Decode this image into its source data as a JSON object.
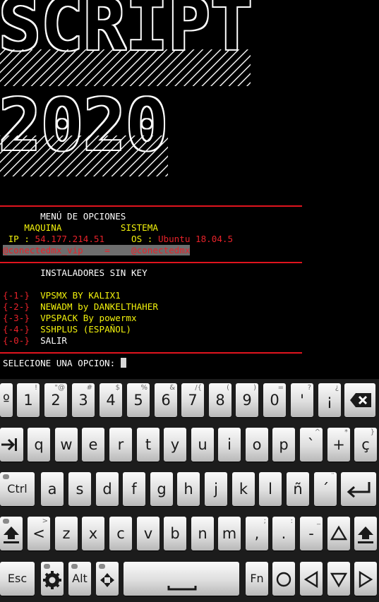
{
  "banner": {
    "line1": "SCRIPT",
    "line2": "2020"
  },
  "menu": {
    "title": "MENÚ DE OPCIONES",
    "col1": "MAQUINA",
    "col2": "SISTEMA",
    "ip_label": "IP : ",
    "ip_value": "54.177.214.51",
    "os_label": "OS : ",
    "os_value": "Ubuntu 18.04.5",
    "credit_left": "@conectedmx_vip",
    "credit_sep": "=",
    "credit_right": "@conectedmx",
    "section": "INSTALADORES SIN KEY",
    "options": [
      {
        "num": "{-1-}",
        "label": "VPSMX BY KALIX1"
      },
      {
        "num": "{-2-}",
        "label": "NEWADM by DANKELTHAHER"
      },
      {
        "num": "{-3-}",
        "label": "VPSPACK By powermx"
      },
      {
        "num": "{-4-}",
        "label": "SSHPLUS (ESPAÑOL)"
      },
      {
        "num": "{-0-}",
        "label": "SALIR"
      }
    ],
    "prompt": "SELECIONE UNA OPCION: "
  },
  "keyboard": {
    "rows": [
      [
        {
          "m": "º",
          "a": ""
        },
        {
          "m": "1",
          "a": "!"
        },
        {
          "m": "2",
          "a": "\"@"
        },
        {
          "m": "3",
          "a": "#"
        },
        {
          "m": "4",
          "a": "$"
        },
        {
          "m": "5",
          "a": "%"
        },
        {
          "m": "6",
          "a": "&"
        },
        {
          "m": "7",
          "a": "/{"
        },
        {
          "m": "8",
          "a": "("
        },
        {
          "m": "9",
          "a": ")"
        },
        {
          "m": "0",
          "a": "="
        },
        {
          "m": "'",
          "a": "?"
        },
        {
          "m": "¡",
          "a": "¿"
        },
        {
          "m": "",
          "a": "",
          "icon": "backspace-icon"
        }
      ],
      [
        {
          "m": "",
          "a": "",
          "icon": "tab-icon"
        },
        {
          "m": "q",
          "a": ""
        },
        {
          "m": "w",
          "a": ""
        },
        {
          "m": "e",
          "a": ""
        },
        {
          "m": "r",
          "a": ""
        },
        {
          "m": "t",
          "a": ""
        },
        {
          "m": "y",
          "a": ""
        },
        {
          "m": "u",
          "a": ""
        },
        {
          "m": "i",
          "a": ""
        },
        {
          "m": "o",
          "a": ""
        },
        {
          "m": "p",
          "a": ""
        },
        {
          "m": "`",
          "a": "^"
        },
        {
          "m": "+",
          "a": "*"
        },
        {
          "m": "ç",
          "a": "}"
        }
      ],
      [
        {
          "m": "Ctrl",
          "a": "",
          "sm": true
        },
        {
          "m": "a",
          "a": ""
        },
        {
          "m": "s",
          "a": ""
        },
        {
          "m": "d",
          "a": ""
        },
        {
          "m": "f",
          "a": ""
        },
        {
          "m": "g",
          "a": ""
        },
        {
          "m": "h",
          "a": ""
        },
        {
          "m": "j",
          "a": ""
        },
        {
          "m": "k",
          "a": ""
        },
        {
          "m": "l",
          "a": ""
        },
        {
          "m": "ñ",
          "a": ""
        },
        {
          "m": "´",
          "a": "¨"
        },
        {
          "m": "",
          "a": "",
          "icon": "enter-icon"
        }
      ],
      [
        {
          "m": "",
          "a": "",
          "icon": "shift-icon"
        },
        {
          "m": "<",
          "a": ">"
        },
        {
          "m": "z",
          "a": ""
        },
        {
          "m": "x",
          "a": ""
        },
        {
          "m": "c",
          "a": ""
        },
        {
          "m": "v",
          "a": ""
        },
        {
          "m": "b",
          "a": ""
        },
        {
          "m": "n",
          "a": ""
        },
        {
          "m": "m",
          "a": ""
        },
        {
          "m": ",",
          "a": ";"
        },
        {
          "m": ".",
          "a": ":"
        },
        {
          "m": "-",
          "a": "_"
        },
        {
          "m": "",
          "a": "",
          "icon": "arrow-up-icon"
        },
        {
          "m": "",
          "a": "",
          "icon": "shift-icon"
        }
      ],
      [
        {
          "m": "Esc",
          "a": "",
          "sm": true
        },
        {
          "m": "",
          "a": "",
          "icon": "settings-icon"
        },
        {
          "m": "Alt",
          "a": "",
          "sm": true
        },
        {
          "m": "",
          "a": "",
          "icon": "dpad-icon"
        },
        {
          "m": "",
          "a": "",
          "icon": "space-icon"
        },
        {
          "m": "Fn",
          "a": "",
          "sm": true
        },
        {
          "m": "",
          "a": "",
          "icon": "circle-icon"
        },
        {
          "m": "",
          "a": "",
          "icon": "arrow-left-icon"
        },
        {
          "m": "",
          "a": "",
          "icon": "arrow-down-icon"
        },
        {
          "m": "",
          "a": "",
          "icon": "arrow-right-icon"
        }
      ]
    ]
  }
}
